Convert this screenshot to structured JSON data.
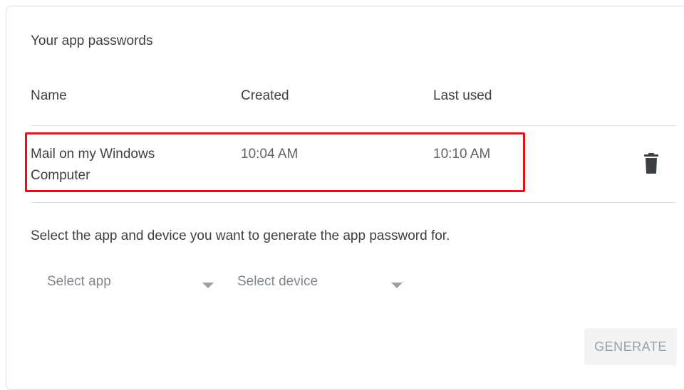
{
  "section": {
    "title": "Your app passwords"
  },
  "table": {
    "headers": {
      "name": "Name",
      "created": "Created",
      "last_used": "Last used"
    },
    "rows": [
      {
        "name": "Mail on my Windows Computer",
        "created": "10:04 AM",
        "last_used": "10:10 AM",
        "action_icon": "trash-icon"
      }
    ]
  },
  "generator": {
    "instruction": "Select the app and device you want to generate the app password for.",
    "app_select": {
      "selected": "Select app"
    },
    "device_select": {
      "selected": "Select device"
    },
    "generate_label": "GENERATE"
  },
  "colors": {
    "highlight": "#e0101b",
    "text": "#3c4043",
    "muted": "#80868b",
    "disabled_button_bg": "#f1f3f4"
  }
}
